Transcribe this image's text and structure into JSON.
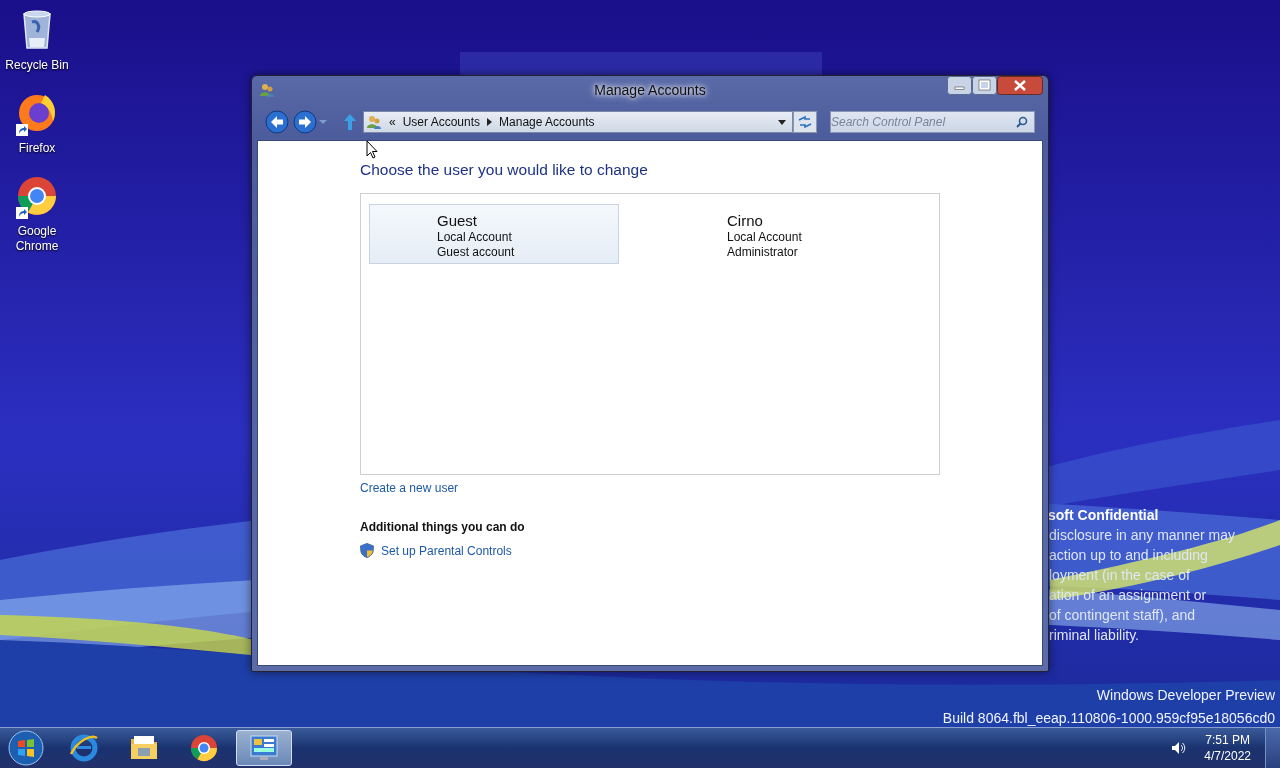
{
  "desktop": {
    "icons": [
      {
        "label": "Recycle Bin",
        "shortcut": false
      },
      {
        "label": "Firefox",
        "shortcut": true
      },
      {
        "label": "Google Chrome",
        "shortcut": true
      }
    ],
    "notice": {
      "title": "soft Confidential",
      "lines": [
        "disclosure in any manner may",
        "action up to and including",
        "loyment (in the case of",
        "ation of an assignment or",
        "of contingent staff), and",
        "riminal liability."
      ]
    },
    "build_info": [
      "Windows Developer Preview",
      "Build 8064.fbl_eeap.110806-1000.959cf95e18056cd0"
    ]
  },
  "window": {
    "title": "Manage Accounts",
    "address": {
      "overflow": "«",
      "crumbs": [
        "User Accounts",
        "Manage Accounts"
      ]
    },
    "search": {
      "placeholder": "Search Control Panel"
    },
    "heading": "Choose the user you would like to change",
    "accounts": [
      {
        "name": "Guest",
        "type": "Local Account",
        "role": "Guest account",
        "selected": true
      },
      {
        "name": "Cirno",
        "type": "Local Account",
        "role": "Administrator",
        "selected": false
      }
    ],
    "create_link": "Create a new user",
    "additional": {
      "title": "Additional things you can do",
      "links": [
        "Set up Parental Controls"
      ]
    }
  },
  "taskbar": {
    "items": [
      {
        "selected": false
      },
      {
        "selected": false
      },
      {
        "selected": false
      },
      {
        "selected": true
      }
    ],
    "clock": {
      "time": "7:51 PM",
      "date": "4/7/2022"
    }
  }
}
